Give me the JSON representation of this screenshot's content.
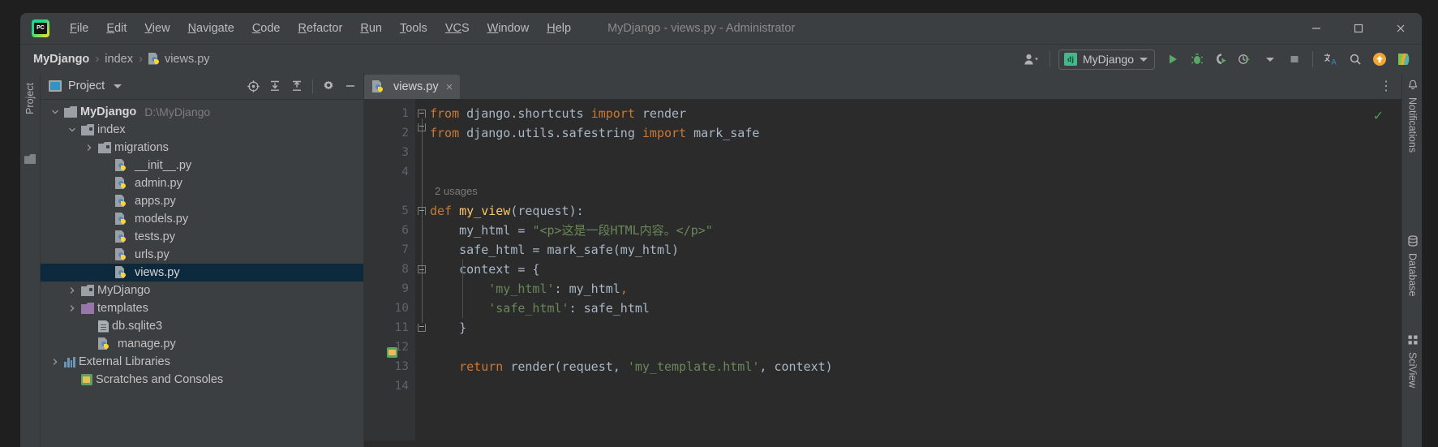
{
  "window": {
    "title": "MyDjango - views.py - Administrator",
    "logo_text": "PC",
    "controls": {
      "minimize": "minimize-button",
      "maximize": "maximize-button",
      "close": "close-button"
    }
  },
  "menu": [
    {
      "label": "File",
      "mnemonic": "F",
      "rest": "ile"
    },
    {
      "label": "Edit",
      "mnemonic": "E",
      "rest": "dit"
    },
    {
      "label": "View",
      "mnemonic": "V",
      "rest": "iew"
    },
    {
      "label": "Navigate",
      "mnemonic": "N",
      "rest": "avigate"
    },
    {
      "label": "Code",
      "mnemonic": "C",
      "rest": "ode"
    },
    {
      "label": "Refactor",
      "mnemonic": "R",
      "rest": "efactor"
    },
    {
      "label": "Run",
      "mnemonic": "R",
      "rest": "un"
    },
    {
      "label": "Tools",
      "mnemonic": "T",
      "rest": "ools"
    },
    {
      "label": "VCS",
      "mnemonic": "VC",
      "rest": "S"
    },
    {
      "label": "Window",
      "mnemonic": "W",
      "rest": "indow"
    },
    {
      "label": "Help",
      "mnemonic": "H",
      "rest": "elp"
    }
  ],
  "breadcrumb": {
    "items": [
      "MyDjango",
      "index",
      "views.py"
    ],
    "separator": "›"
  },
  "toolbar": {
    "run_config": {
      "icon_text": "dj",
      "label": "MyDjango"
    },
    "icons": [
      "user-account-icon",
      "run-icon",
      "debug-icon",
      "run-coverage-icon",
      "profile-icon",
      "stop-icon",
      "translate-icon",
      "search-everywhere-icon",
      "update-icon",
      "tool-icon"
    ]
  },
  "left_strip": {
    "label": "Project"
  },
  "project_panel": {
    "title": "Project",
    "tools": [
      "locate-icon",
      "expand-all-icon",
      "collapse-all-icon",
      "settings-icon",
      "hide-icon"
    ],
    "tree": [
      {
        "label": "MyDjango",
        "path": "D:\\MyDjango",
        "icon": "folder-root",
        "arrow": "down",
        "depth": 0,
        "bold": true,
        "selected": false
      },
      {
        "label": "index",
        "path": "",
        "icon": "folder-source",
        "arrow": "down",
        "depth": 1,
        "bold": false,
        "selected": false
      },
      {
        "label": "migrations",
        "path": "",
        "icon": "folder-source",
        "arrow": "right",
        "depth": 2,
        "bold": false,
        "selected": false
      },
      {
        "label": "__init__.py",
        "path": "",
        "icon": "python-file",
        "arrow": "none",
        "depth": 3,
        "bold": false,
        "selected": false
      },
      {
        "label": "admin.py",
        "path": "",
        "icon": "python-file",
        "arrow": "none",
        "depth": 3,
        "bold": false,
        "selected": false
      },
      {
        "label": "apps.py",
        "path": "",
        "icon": "python-file",
        "arrow": "none",
        "depth": 3,
        "bold": false,
        "selected": false
      },
      {
        "label": "models.py",
        "path": "",
        "icon": "python-file",
        "arrow": "none",
        "depth": 3,
        "bold": false,
        "selected": false
      },
      {
        "label": "tests.py",
        "path": "",
        "icon": "python-file",
        "arrow": "none",
        "depth": 3,
        "bold": false,
        "selected": false
      },
      {
        "label": "urls.py",
        "path": "",
        "icon": "python-file",
        "arrow": "none",
        "depth": 3,
        "bold": false,
        "selected": false
      },
      {
        "label": "views.py",
        "path": "",
        "icon": "python-file",
        "arrow": "none",
        "depth": 3,
        "bold": false,
        "selected": true
      },
      {
        "label": "MyDjango",
        "path": "",
        "icon": "folder-source",
        "arrow": "right",
        "depth": 1,
        "bold": false,
        "selected": false
      },
      {
        "label": "templates",
        "path": "",
        "icon": "folder-template",
        "arrow": "right",
        "depth": 1,
        "bold": false,
        "selected": false
      },
      {
        "label": "db.sqlite3",
        "path": "",
        "icon": "db-file",
        "arrow": "none",
        "depth": 2,
        "bold": false,
        "selected": false
      },
      {
        "label": "manage.py",
        "path": "",
        "icon": "python-file",
        "arrow": "none",
        "depth": 2,
        "bold": false,
        "selected": false
      },
      {
        "label": "External Libraries",
        "path": "",
        "icon": "library",
        "arrow": "right",
        "depth": 0,
        "bold": false,
        "selected": false
      },
      {
        "label": "Scratches and Consoles",
        "path": "",
        "icon": "scratch",
        "arrow": "none",
        "depth": 1,
        "bold": false,
        "selected": false
      }
    ]
  },
  "editor": {
    "tab": {
      "label": "views.py",
      "close": "×"
    },
    "more_menu": "⋮",
    "inspection_status": "✓",
    "usages_hint": "2 usages",
    "line_numbers": [
      "1",
      "2",
      "3",
      "4",
      "5",
      "6",
      "7",
      "8",
      "9",
      "10",
      "11",
      "12",
      "13",
      "14"
    ],
    "lines": [
      {
        "n": 1,
        "tokens": [
          {
            "t": "from",
            "c": "kw"
          },
          {
            "t": " django.shortcuts ",
            "c": "pln"
          },
          {
            "t": "import",
            "c": "kw"
          },
          {
            "t": " render",
            "c": "pln"
          }
        ]
      },
      {
        "n": 2,
        "tokens": [
          {
            "t": "from",
            "c": "kw"
          },
          {
            "t": " django.utils.safestring ",
            "c": "pln"
          },
          {
            "t": "import",
            "c": "kw"
          },
          {
            "t": " mark_safe",
            "c": "pln"
          }
        ]
      },
      {
        "n": 3,
        "tokens": []
      },
      {
        "n": 4,
        "tokens": []
      },
      {
        "n": 5,
        "tokens": [
          {
            "t": "def",
            "c": "kw"
          },
          {
            "t": " ",
            "c": "pln"
          },
          {
            "t": "my_view",
            "c": "fn"
          },
          {
            "t": "(request):",
            "c": "pln"
          }
        ]
      },
      {
        "n": 6,
        "tokens": [
          {
            "t": "    my_html = ",
            "c": "pln"
          },
          {
            "t": "\"<p>这是一段HTML内容。</p>\"",
            "c": "str"
          }
        ]
      },
      {
        "n": 7,
        "tokens": [
          {
            "t": "    safe_html = mark_safe(my_html)",
            "c": "pln"
          }
        ]
      },
      {
        "n": 8,
        "tokens": [
          {
            "t": "    context = {",
            "c": "pln"
          }
        ]
      },
      {
        "n": 9,
        "tokens": [
          {
            "t": "        ",
            "c": "pln"
          },
          {
            "t": "'my_html'",
            "c": "str"
          },
          {
            "t": ": my_html",
            "c": "pln"
          },
          {
            "t": ",",
            "c": "comma"
          }
        ]
      },
      {
        "n": 10,
        "tokens": [
          {
            "t": "        ",
            "c": "pln"
          },
          {
            "t": "'safe_html'",
            "c": "str"
          },
          {
            "t": ": safe_html",
            "c": "pln"
          }
        ]
      },
      {
        "n": 11,
        "tokens": [
          {
            "t": "    }",
            "c": "pln"
          }
        ]
      },
      {
        "n": 12,
        "tokens": []
      },
      {
        "n": 13,
        "tokens": [
          {
            "t": "    ",
            "c": "pln"
          },
          {
            "t": "return",
            "c": "kw"
          },
          {
            "t": " render(request, ",
            "c": "pln"
          },
          {
            "t": "'my_template.html'",
            "c": "str"
          },
          {
            "t": ", context)",
            "c": "pln"
          }
        ]
      },
      {
        "n": 14,
        "tokens": []
      }
    ]
  },
  "right_strip": {
    "items": [
      {
        "label": "Notifications",
        "icon": "bell-icon"
      },
      {
        "label": "Database",
        "icon": "database-icon"
      },
      {
        "label": "SciView",
        "icon": "grid-icon"
      }
    ]
  },
  "colors": {
    "bg_panel": "#3c3f41",
    "bg_editor": "#2b2b2b",
    "gutter": "#313335",
    "selection": "#0d293e",
    "keyword": "#cc7832",
    "string": "#6a8759",
    "function": "#ffc66d",
    "plain": "#a9b7c6",
    "accent_green": "#499c54"
  }
}
